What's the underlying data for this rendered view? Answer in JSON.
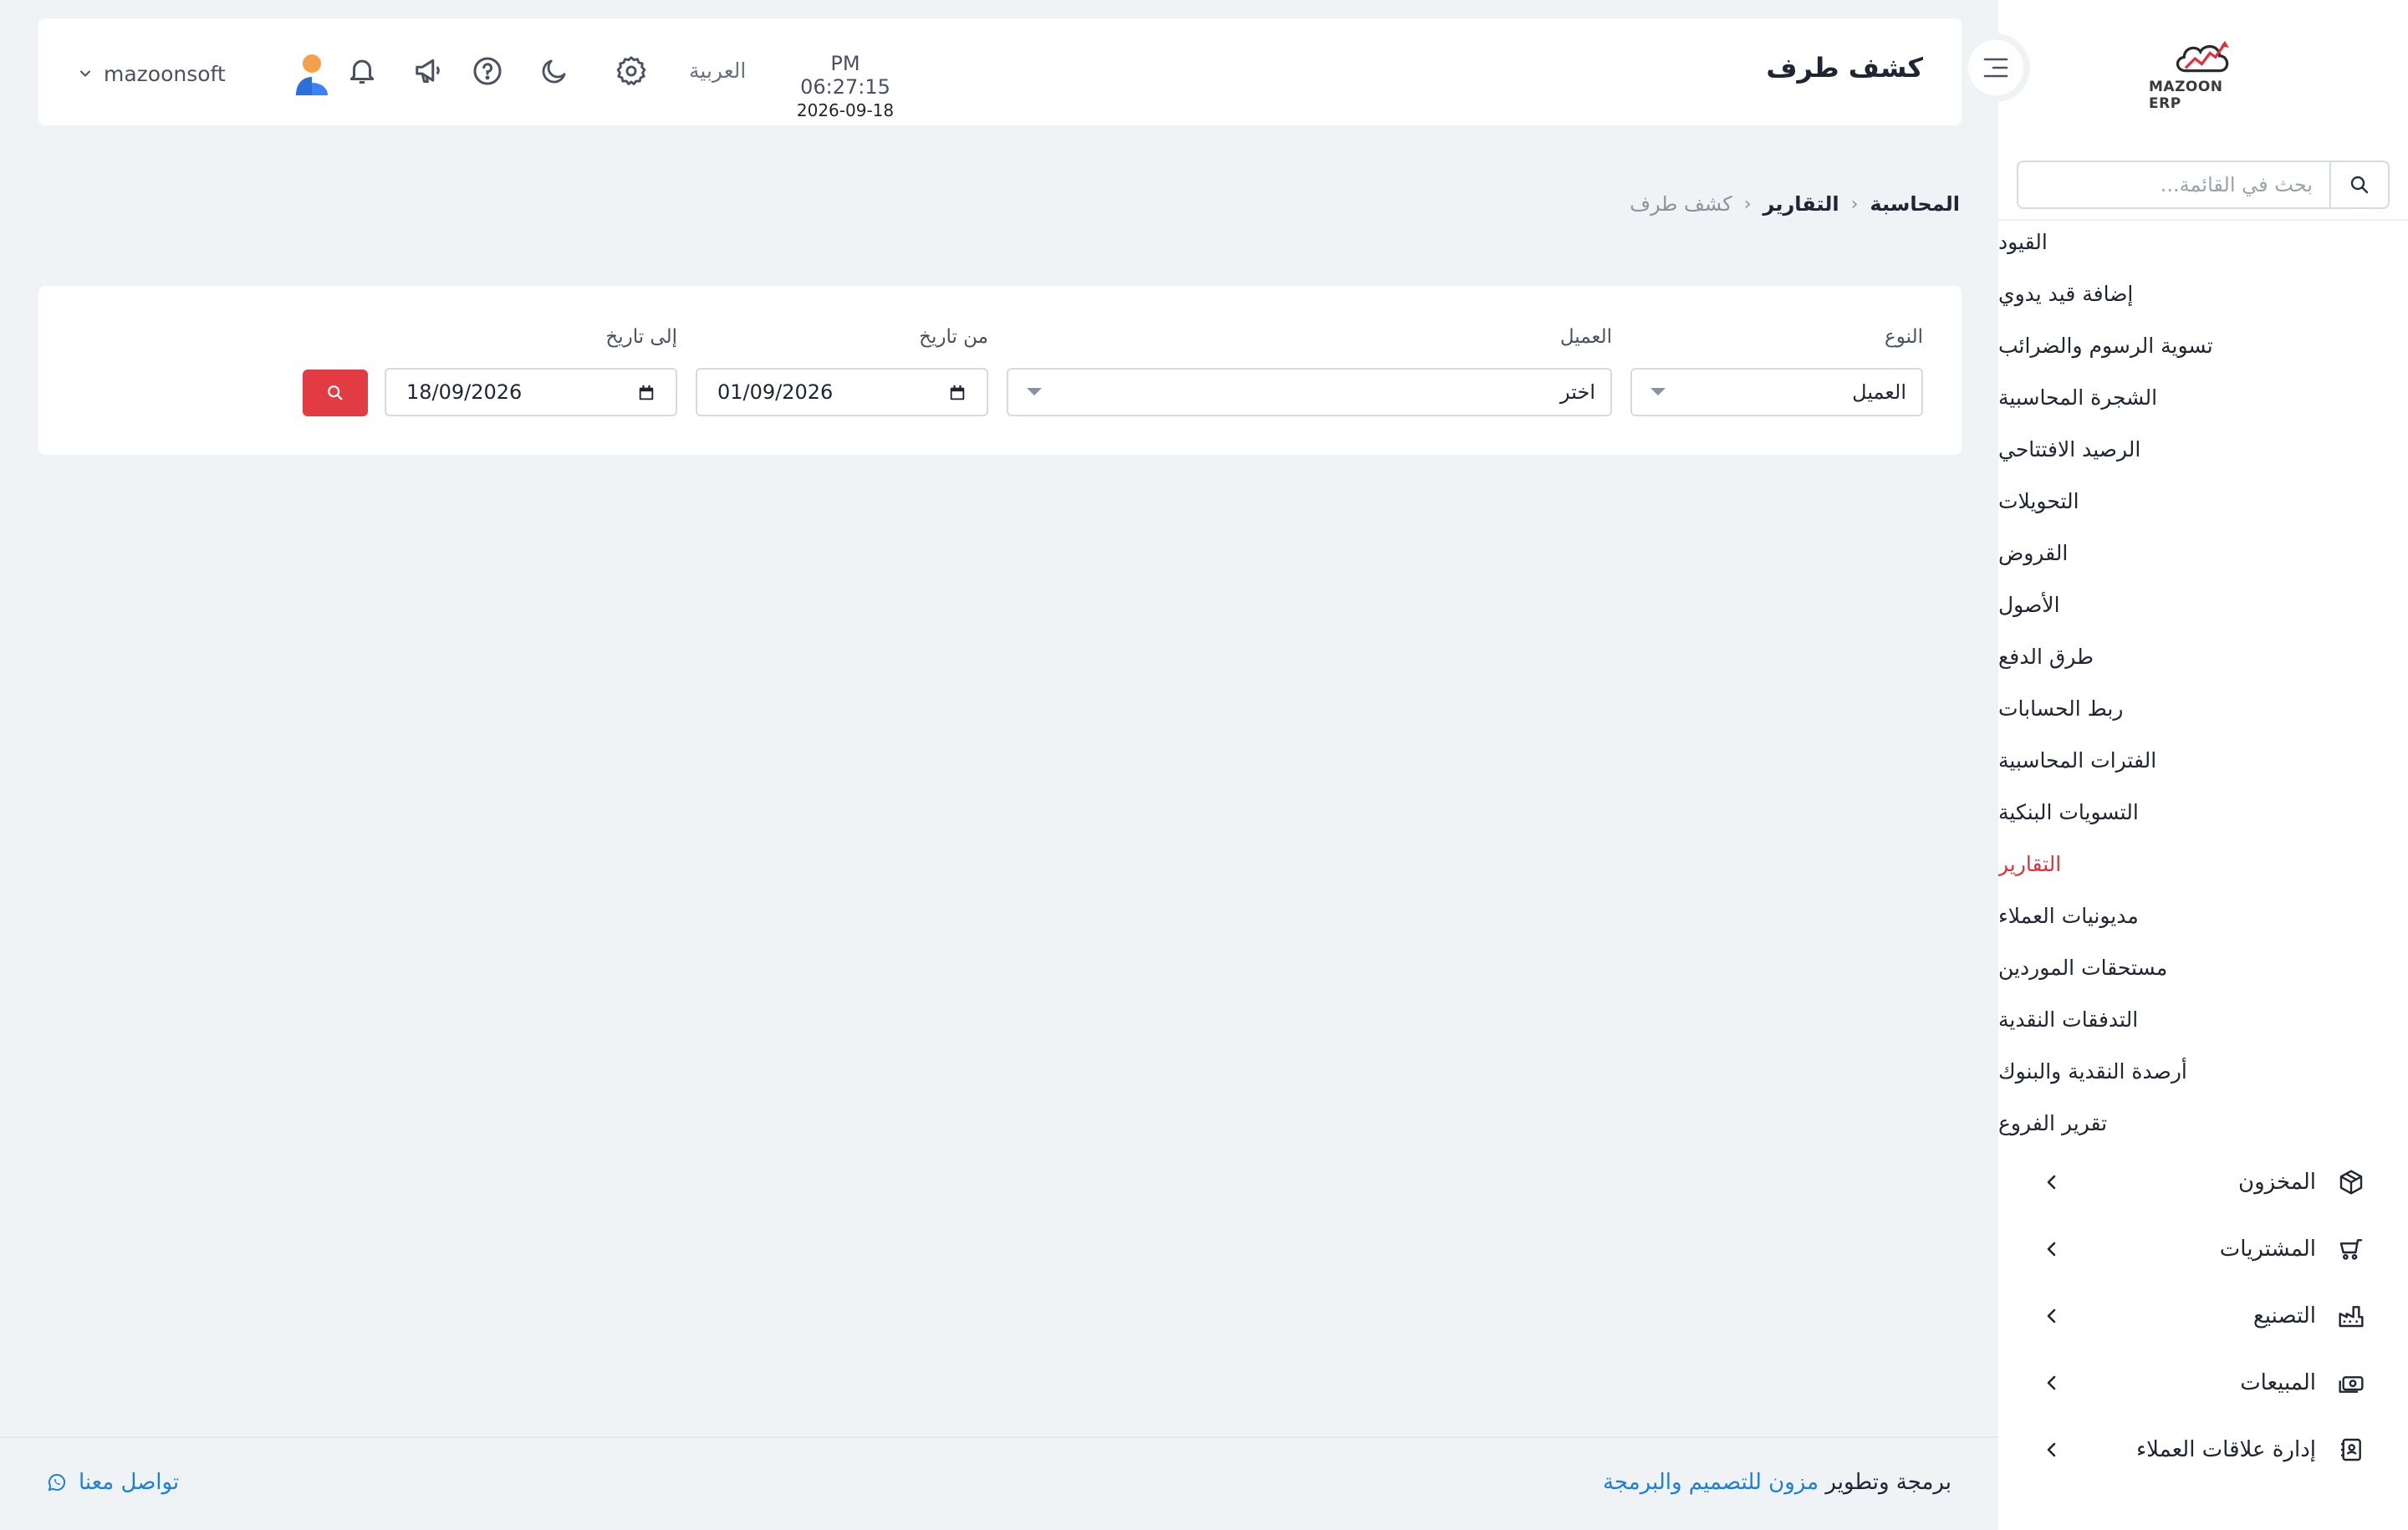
{
  "sidebar": {
    "brand": "MAZOON ERP",
    "search_placeholder": "بحث في القائمة...",
    "sub_items": [
      {
        "label": "القيود"
      },
      {
        "label": "إضافة قيد يدوي"
      },
      {
        "label": "تسوية الرسوم والضرائب"
      },
      {
        "label": "الشجرة المحاسبية"
      },
      {
        "label": "الرصيد الافتتاحي"
      },
      {
        "label": "التحويلات"
      },
      {
        "label": "القروض"
      },
      {
        "label": "الأصول"
      },
      {
        "label": "طرق الدفع"
      },
      {
        "label": "ربط الحسابات"
      },
      {
        "label": "الفترات المحاسبية"
      },
      {
        "label": "التسويات البنكية"
      },
      {
        "label": "التقارير",
        "active": true
      },
      {
        "label": "مديونيات العملاء"
      },
      {
        "label": "مستحقات الموردين"
      },
      {
        "label": "التدفقات النقدية"
      },
      {
        "label": "أرصدة النقدية والبنوك"
      },
      {
        "label": "تقرير الفروع"
      }
    ],
    "groups": [
      {
        "label": "المخزون",
        "icon": "box-icon"
      },
      {
        "label": "المشتريات",
        "icon": "cart-icon"
      },
      {
        "label": "التصنيع",
        "icon": "factory-icon"
      },
      {
        "label": "المبيعات",
        "icon": "cash-icon"
      },
      {
        "label": "إدارة علاقات العملاء",
        "icon": "contacts-icon"
      }
    ]
  },
  "header": {
    "title": "كشف طرف",
    "time": "PM 06:27:15",
    "date": "2026-09-18",
    "language": "العربية",
    "username": "mazoonsoft"
  },
  "breadcrumb": [
    "المحاسبة",
    "التقارير",
    "كشف طرف"
  ],
  "filters": {
    "type_label": "النوع",
    "type_value": "العميل",
    "client_label": "العميل",
    "client_value": "اختر",
    "from_label": "من تاريخ",
    "from_value": "01/09/2026",
    "to_label": "إلى تاريخ",
    "to_value": "18/09/2026"
  },
  "footer": {
    "credit_prefix": "برمجة وتطوير",
    "credit_link": "مزون للتصميم والبرمجة",
    "contact": "تواصل معنا"
  },
  "colors": {
    "accent": "#e23b43",
    "link": "#1e7fd6",
    "background": "#f0f3f6"
  }
}
